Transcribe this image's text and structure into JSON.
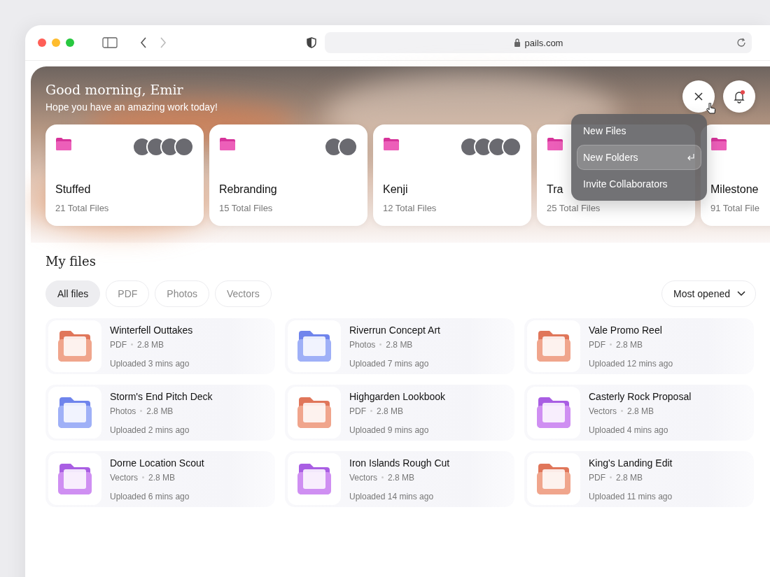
{
  "browser": {
    "address": "pails.com"
  },
  "hero": {
    "greeting": "Good morning, Emir",
    "subtitle": "Hope you have an amazing work today!",
    "notification_unread": true
  },
  "folders": [
    {
      "name": "Stuffed",
      "count": "21 Total Files",
      "avatars": [
        {
          "kind": "photo"
        },
        {
          "kind": "photo"
        },
        {
          "kind": "photo"
        },
        {
          "kind": "photo"
        }
      ]
    },
    {
      "name": "Rebranding",
      "count": "15 Total Files",
      "avatars": [
        {
          "kind": "photo"
        },
        {
          "kind": "photo"
        }
      ]
    },
    {
      "name": "Kenji",
      "count": "12 Total Files",
      "avatars": [
        {
          "kind": "photo"
        },
        {
          "kind": "photo"
        },
        {
          "kind": "photo"
        },
        {
          "kind": "photo"
        }
      ]
    },
    {
      "name": "Tra",
      "count": "25 Total Files"
    },
    {
      "name": "Milestone",
      "count": "91 Total File"
    }
  ],
  "menu": {
    "items": [
      {
        "label": "New Files",
        "selected": false
      },
      {
        "label": "New Folders",
        "selected": true
      },
      {
        "label": "Invite Collaborators",
        "selected": false
      }
    ]
  },
  "my_files": {
    "title": "My files",
    "filters": [
      {
        "label": "All files",
        "selected": true
      },
      {
        "label": "PDF",
        "selected": false
      },
      {
        "label": "Photos",
        "selected": false
      },
      {
        "label": "Vectors",
        "selected": false
      }
    ],
    "sort": "Most opened",
    "files": [
      {
        "name": "Winterfell Outtakes",
        "kind": "pdf",
        "type": "PDF",
        "size": "2.8 MB",
        "uploaded": "Uploaded 3 mins ago"
      },
      {
        "name": "Riverrun Concept Art",
        "kind": "photos",
        "type": "Photos",
        "size": "2.8 MB",
        "uploaded": "Uploaded 7 mins ago"
      },
      {
        "name": "Vale Promo Reel",
        "kind": "pdf",
        "type": "PDF",
        "size": "2.8 MB",
        "uploaded": "Uploaded 12 mins ago"
      },
      {
        "name": "Storm's End Pitch Deck",
        "kind": "photos",
        "type": "Photos",
        "size": "2.8 MB",
        "uploaded": "Uploaded 2 mins ago"
      },
      {
        "name": "Highgarden Lookbook",
        "kind": "pdf",
        "type": "PDF",
        "size": "2.8 MB",
        "uploaded": "Uploaded 9 mins ago"
      },
      {
        "name": "Casterly Rock Proposal",
        "kind": "vectors",
        "type": "Vectors",
        "size": "2.8 MB",
        "uploaded": "Uploaded 4 mins ago"
      },
      {
        "name": "Dorne Location Scout",
        "kind": "vectors",
        "type": "Vectors",
        "size": "2.8 MB",
        "uploaded": "Uploaded 6 mins ago"
      },
      {
        "name": "Iron Islands Rough Cut",
        "kind": "vectors",
        "type": "Vectors",
        "size": "2.8 MB",
        "uploaded": "Uploaded 14 mins ago"
      },
      {
        "name": "King's Landing Edit",
        "kind": "pdf",
        "type": "PDF",
        "size": "2.8 MB",
        "uploaded": "Uploaded 11 mins ago"
      }
    ]
  }
}
